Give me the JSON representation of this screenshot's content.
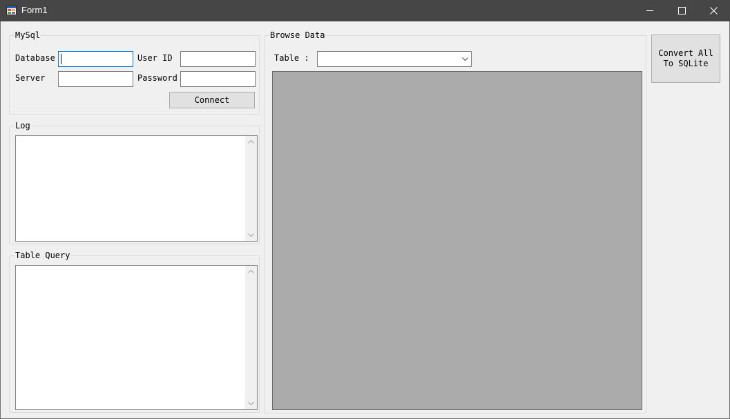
{
  "window": {
    "title": "Form1",
    "icons": {
      "app": "form-app-icon",
      "minimize": "minimize-icon",
      "maximize": "maximize-icon",
      "close": "close-icon"
    }
  },
  "mysql": {
    "group_label": "MySql",
    "database_label": "Database",
    "database_value": "",
    "userid_label": "User ID",
    "userid_value": "",
    "server_label": "Server",
    "server_value": "",
    "password_label": "Password",
    "password_value": "",
    "connect_label": "Connect"
  },
  "log": {
    "group_label": "Log"
  },
  "table_query": {
    "group_label": "Table Query"
  },
  "browse": {
    "group_label": "Browse Data",
    "table_label": "Table :",
    "table_selected": ""
  },
  "convert": {
    "line1": "Convert All",
    "line2": "To SQLite"
  },
  "colors": {
    "titlebar": "#464646",
    "form_background": "#f0f0f0",
    "grid_background": "#ababab",
    "focus_border": "#0078d7"
  }
}
